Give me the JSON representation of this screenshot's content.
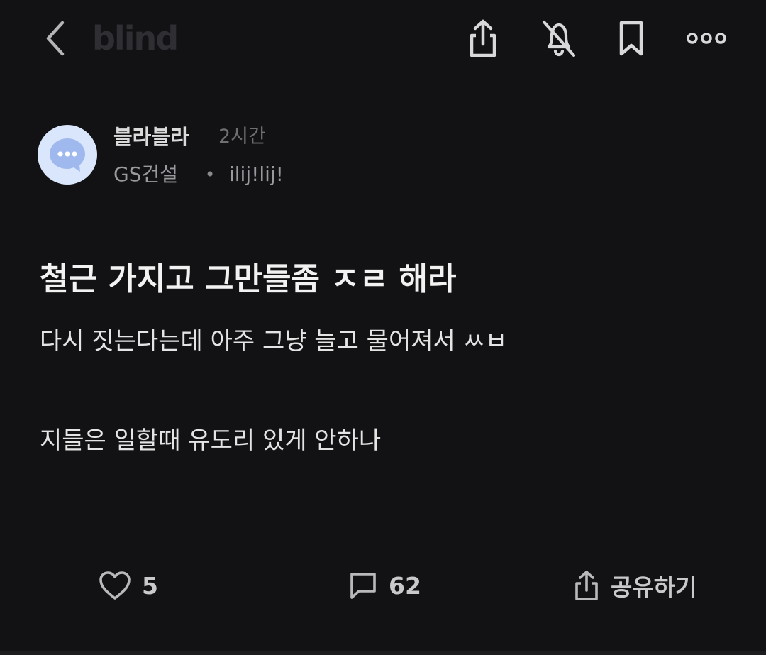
{
  "app": {
    "logo": "blind"
  },
  "author": {
    "name": "블라블라",
    "time": "2시간",
    "company": "GS건설",
    "separator": "•",
    "nickname": "ilij!lij!"
  },
  "post": {
    "title": "철근 가지고 그만들좀 ㅈㄹ 해라",
    "lines": [
      "다시 짓는다는데 아주 그냥 늘고 물어져서 ㅆㅂ",
      "지들은 일할때 유도리 있게 안하나"
    ]
  },
  "actions": {
    "likes": "5",
    "comments": "62",
    "share_label": "공유하기"
  },
  "colors": {
    "background": "#121214",
    "logo": "#2e2e33",
    "avatar_bg": "#d9e6fb",
    "avatar_icon": "#9fb9ee"
  },
  "icons": {
    "back": "chevron-left-icon",
    "share": "share-icon",
    "notifications_off": "bell-off-icon",
    "bookmark": "bookmark-icon",
    "more": "more-horizontal-icon",
    "avatar": "chat-bubble-icon",
    "like": "heart-icon",
    "comment": "comment-icon",
    "share_action": "share-icon"
  }
}
